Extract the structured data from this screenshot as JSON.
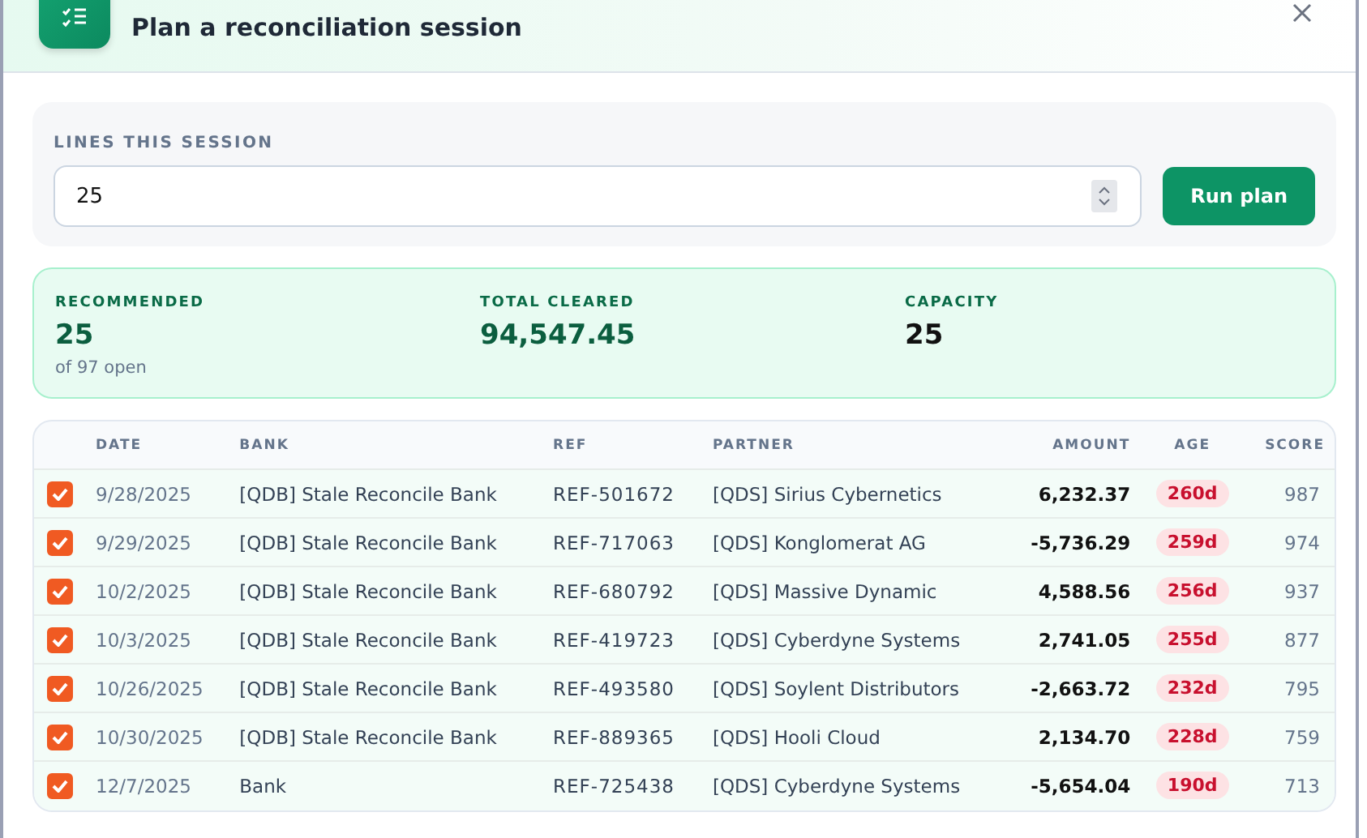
{
  "dialog": {
    "title": "Plan a reconciliation session"
  },
  "session": {
    "label": "LINES THIS SESSION",
    "value": "25",
    "button": "Run plan"
  },
  "summary": [
    {
      "label": "RECOMMENDED",
      "value": "25",
      "note": "of 97 open",
      "highlighted": true
    },
    {
      "label": "TOTAL CLEARED",
      "value": "94,547.45",
      "highlighted": true
    },
    {
      "label": "CAPACITY",
      "value": "25",
      "highlighted": false
    }
  ],
  "table": {
    "columns": [
      "DATE",
      "BANK",
      "REF",
      "PARTNER",
      "AMOUNT",
      "AGE",
      "SCORE"
    ],
    "rows": [
      {
        "checked": true,
        "date": "9/28/2025",
        "bank": "[QDB] Stale Reconcile Bank",
        "ref": "REF-501672",
        "partner": "[QDS] Sirius Cybernetics",
        "amount": "6,232.37",
        "age": "260d",
        "score": "987"
      },
      {
        "checked": true,
        "date": "9/29/2025",
        "bank": "[QDB] Stale Reconcile Bank",
        "ref": "REF-717063",
        "partner": "[QDS] Konglomerat AG",
        "amount": "-5,736.29",
        "age": "259d",
        "score": "974"
      },
      {
        "checked": true,
        "date": "10/2/2025",
        "bank": "[QDB] Stale Reconcile Bank",
        "ref": "REF-680792",
        "partner": "[QDS] Massive Dynamic",
        "amount": "4,588.56",
        "age": "256d",
        "score": "937"
      },
      {
        "checked": true,
        "date": "10/3/2025",
        "bank": "[QDB] Stale Reconcile Bank",
        "ref": "REF-419723",
        "partner": "[QDS] Cyberdyne Systems",
        "amount": "2,741.05",
        "age": "255d",
        "score": "877"
      },
      {
        "checked": true,
        "date": "10/26/2025",
        "bank": "[QDB] Stale Reconcile Bank",
        "ref": "REF-493580",
        "partner": "[QDS] Soylent Distributors",
        "amount": "-2,663.72",
        "age": "232d",
        "score": "795"
      },
      {
        "checked": true,
        "date": "10/30/2025",
        "bank": "[QDB] Stale Reconcile Bank",
        "ref": "REF-889365",
        "partner": "[QDS] Hooli Cloud",
        "amount": "2,134.70",
        "age": "228d",
        "score": "759"
      },
      {
        "checked": true,
        "date": "12/7/2025",
        "bank": "Bank",
        "ref": "REF-725438",
        "partner": "[QDS] Cyberdyne Systems",
        "amount": "-5,654.04",
        "age": "190d",
        "score": "713"
      }
    ]
  }
}
